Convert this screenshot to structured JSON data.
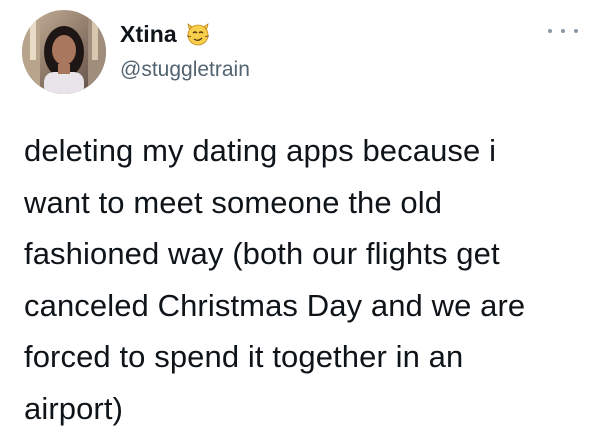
{
  "tweet": {
    "author": {
      "display_name": "Xtina",
      "name_emoji": "smirking-cat-emoji",
      "handle": "@stuggletrain"
    },
    "more_icon": "more-horizontal-icon",
    "text": "deleting my dating apps because i\nwant to meet someone the old\nfashioned way (both our flights get\ncanceled Christmas Day and we are\nforced to spend it together in an\nairport)"
  },
  "colors": {
    "text": "#0f1419",
    "secondary_text": "#536471",
    "icon_gray": "#8b98a5",
    "background": "#ffffff"
  }
}
